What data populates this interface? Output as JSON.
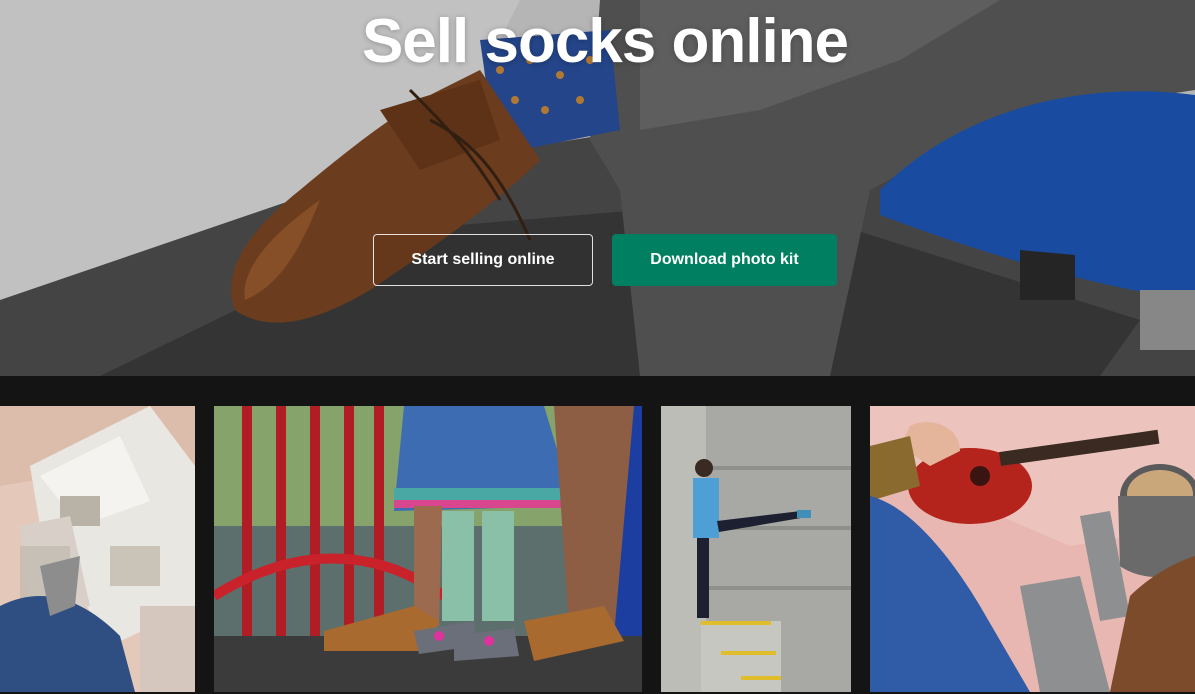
{
  "hero": {
    "title": "Sell socks online",
    "buttons": {
      "secondary_label": "Start selling online",
      "primary_label": "Download photo kit"
    }
  },
  "colors": {
    "primary_button": "#008060",
    "page_background": "#141414",
    "title_text": "#ffffff"
  },
  "gallery": {
    "tiles": [
      {
        "subject": "magazine-on-bed-with-socks-photo"
      },
      {
        "subject": "child-and-adult-feet-on-playground-photo"
      },
      {
        "subject": "person-kicking-against-concrete-wall-photo"
      },
      {
        "subject": "socks-ukulele-and-coffee-photo"
      }
    ]
  }
}
